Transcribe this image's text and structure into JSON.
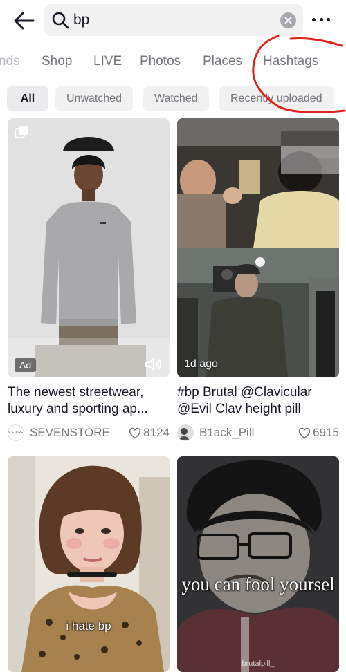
{
  "search": {
    "query": "bp"
  },
  "tabs": [
    {
      "label": "nds"
    },
    {
      "label": "Shop"
    },
    {
      "label": "LIVE"
    },
    {
      "label": "Photos"
    },
    {
      "label": "Places"
    },
    {
      "label": "Hashtags"
    }
  ],
  "filters": [
    {
      "label": "All",
      "selected": true
    },
    {
      "label": "Unwatched"
    },
    {
      "label": "Watched"
    },
    {
      "label": "Recently uploaded"
    }
  ],
  "annotation_color": "#e0201c",
  "feed": [
    {
      "badge": "Ad",
      "title": "The newest streetwear, luxury and sporting ap...",
      "author": "SEVENSTORE",
      "logo_text": "SEVEN STORE .COM",
      "likes": "8124",
      "icons": [
        "square-icon",
        "volume-icon"
      ]
    },
    {
      "badge": "1d ago",
      "title": "#bp Brutal @Clavicular @Evil Clav height pill",
      "author": "B1ack_Pill",
      "likes": "6915"
    },
    {
      "caption": "i hate bp"
    },
    {
      "caption": "you can fool yoursel",
      "watermark": "brutalpill_"
    }
  ]
}
